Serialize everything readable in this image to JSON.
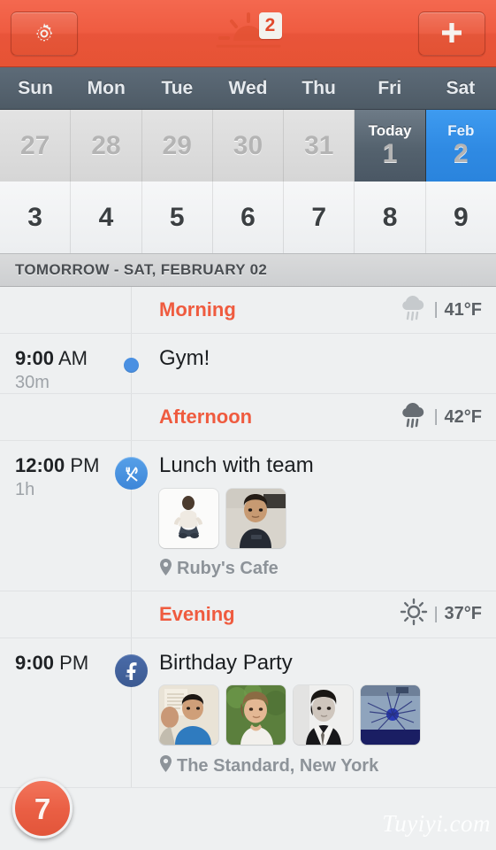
{
  "topbar": {
    "settings_icon": "gear-icon",
    "sunrise_icon": "sunrise-icon",
    "badge_count": "2",
    "add_icon": "plus-icon"
  },
  "weekdays": [
    "Sun",
    "Mon",
    "Tue",
    "Wed",
    "Thu",
    "Fri",
    "Sat"
  ],
  "date_rows": [
    [
      {
        "num": "27",
        "label": "",
        "state": "muted"
      },
      {
        "num": "28",
        "label": "",
        "state": "muted"
      },
      {
        "num": "29",
        "label": "",
        "state": "muted"
      },
      {
        "num": "30",
        "label": "",
        "state": "muted"
      },
      {
        "num": "31",
        "label": "",
        "state": "muted"
      },
      {
        "num": "1",
        "label": "Today",
        "state": "today"
      },
      {
        "num": "2",
        "label": "Feb",
        "state": "selected"
      }
    ],
    [
      {
        "num": "3",
        "label": "",
        "state": "normal"
      },
      {
        "num": "4",
        "label": "",
        "state": "normal"
      },
      {
        "num": "5",
        "label": "",
        "state": "normal"
      },
      {
        "num": "6",
        "label": "",
        "state": "normal"
      },
      {
        "num": "7",
        "label": "",
        "state": "normal"
      },
      {
        "num": "8",
        "label": "",
        "state": "normal"
      },
      {
        "num": "9",
        "label": "",
        "state": "normal"
      }
    ]
  ],
  "day_header": "TOMORROW - SAT, FEBRUARY 02",
  "agenda": {
    "morning": {
      "label": "Morning",
      "weather_icon": "rain-cloud-icon",
      "separator": "|",
      "temp": "41°F"
    },
    "gym": {
      "time_hour": "9:00",
      "time_meridiem": "AM",
      "duration": "30m",
      "icon": "blue-dot-icon",
      "title": "Gym!"
    },
    "afternoon": {
      "label": "Afternoon",
      "weather_icon": "rain-cloud-icon",
      "separator": "|",
      "temp": "42°F"
    },
    "lunch": {
      "time_hour": "12:00",
      "time_meridiem": "PM",
      "duration": "1h",
      "icon": "fork-knife-icon",
      "title": "Lunch with team",
      "location_icon": "map-pin-icon",
      "location": "Ruby's Cafe",
      "attendees": [
        "attendee-photo-1",
        "attendee-photo-2"
      ]
    },
    "evening": {
      "label": "Evening",
      "weather_icon": "sun-icon",
      "separator": "|",
      "temp": "37°F"
    },
    "birthday": {
      "time_hour": "9:00",
      "time_meridiem": "PM",
      "duration": "",
      "icon": "facebook-icon",
      "title": "Birthday Party",
      "location_icon": "map-pin-icon",
      "location": "The Standard, New York",
      "attendees": [
        "attendee-photo-1",
        "attendee-photo-2",
        "attendee-photo-3",
        "attendee-photo-4"
      ]
    }
  },
  "fab": {
    "label": "7",
    "icon": "today-count-icon"
  },
  "watermark": "Tuyiyi.com",
  "colors": {
    "accent": "#ef5b3f",
    "selected_day": "#2f8ae3",
    "today_day": "#54626e",
    "facebook": "#3c5a92",
    "lunch_blue": "#3d86d8"
  }
}
